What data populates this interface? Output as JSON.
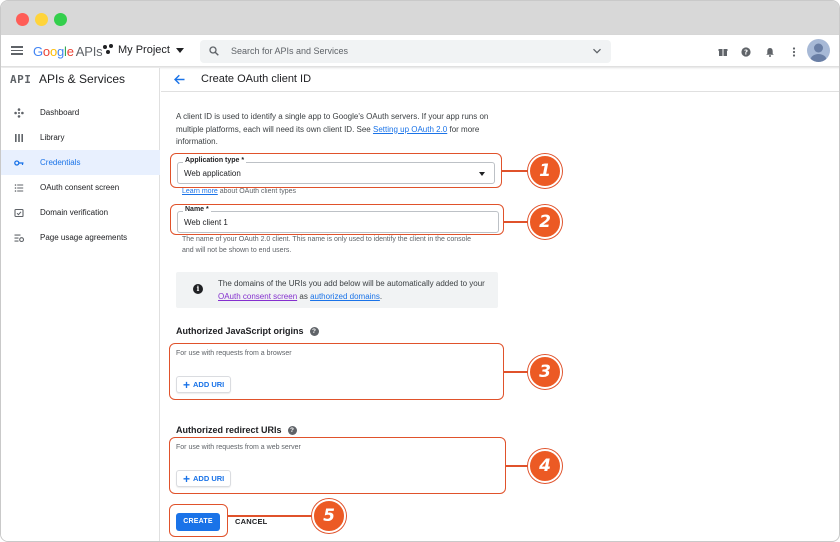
{
  "topbar": {
    "logo_google": [
      "G",
      "o",
      "o",
      "g",
      "l",
      "e"
    ],
    "logo_apis": "APIs",
    "project_name": "My Project",
    "search_placeholder": "Search for APIs and Services"
  },
  "sidebar": {
    "api_label": "API",
    "title": "APIs & Services",
    "items": [
      {
        "label": "Dashboard",
        "icon": "dashboard-icon",
        "active": false
      },
      {
        "label": "Library",
        "icon": "library-icon",
        "active": false
      },
      {
        "label": "Credentials",
        "icon": "key-icon",
        "active": true
      },
      {
        "label": "OAuth consent screen",
        "icon": "consent-icon",
        "active": false
      },
      {
        "label": "Domain verification",
        "icon": "domain-verification-icon",
        "active": false
      },
      {
        "label": "Page usage agreements",
        "icon": "settings-list-icon",
        "active": false
      }
    ]
  },
  "main": {
    "title": "Create OAuth client ID",
    "intro_text": "A client ID is used to identify a single app to Google's OAuth servers. If your app runs on multiple platforms, each will need its own client ID. See ",
    "intro_link": "Setting up OAuth 2.0",
    "intro_tail": " for more information.",
    "app_type_label": "Application type *",
    "app_type_value": "Web application",
    "learn_more_link": "Learn more",
    "learn_more_tail": " about OAuth client types",
    "name_label": "Name *",
    "name_value": "Web client 1",
    "name_helper": "The name of your OAuth 2.0 client. This name is only used to identify the client in the console and will not be shown to end users.",
    "info_text_1": "The domains of the URIs you add below will be automatically added to your ",
    "info_link_1": "OAuth consent screen",
    "info_text_2": " as ",
    "info_link_2": "authorized domains",
    "info_text_3": ".",
    "js_origins_title": "Authorized JavaScript origins",
    "js_origins_placeholder": "For use with requests from a browser",
    "redirect_title": "Authorized redirect URIs",
    "redirect_placeholder": "For use with requests from a web server",
    "add_uri_label": "ADD URI",
    "create_label": "CREATE",
    "cancel_label": "CANCEL"
  },
  "annotations": {
    "color": "#ec5a24",
    "badges": [
      "1",
      "2",
      "3",
      "4",
      "5"
    ]
  }
}
